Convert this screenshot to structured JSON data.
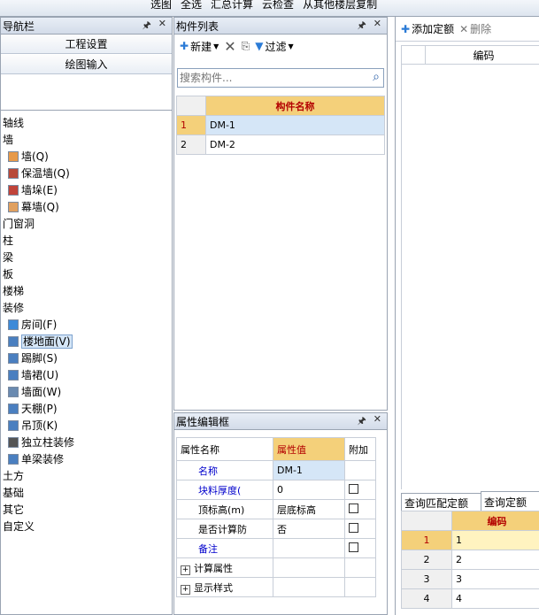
{
  "top_toolbar": {
    "items": [
      "选图",
      "全选",
      "汇总计算",
      "云检查",
      "从其他楼层复制"
    ]
  },
  "nav_panel": {
    "title": "导航栏",
    "buttons": [
      "工程设置",
      "绘图输入"
    ],
    "tree": [
      {
        "label": "轴线",
        "indent": 0
      },
      {
        "label": "墙",
        "indent": 0
      },
      {
        "label": "墙(Q)",
        "indent": 1,
        "icon": "wall-icon"
      },
      {
        "label": "保温墙(Q)",
        "indent": 1,
        "icon": "insulation-wall-icon"
      },
      {
        "label": "墙垛(E)",
        "indent": 1,
        "icon": "wall-pier-icon"
      },
      {
        "label": "幕墙(Q)",
        "indent": 1,
        "icon": "curtain-wall-icon"
      },
      {
        "label": "门窗洞",
        "indent": 0
      },
      {
        "label": "柱",
        "indent": 0
      },
      {
        "label": "梁",
        "indent": 0
      },
      {
        "label": "板",
        "indent": 0
      },
      {
        "label": "楼梯",
        "indent": 0
      },
      {
        "label": "装修",
        "indent": 0
      },
      {
        "label": "房间(F)",
        "indent": 1,
        "icon": "room-icon"
      },
      {
        "label": "楼地面(V)",
        "indent": 1,
        "icon": "floor-icon",
        "selected": true
      },
      {
        "label": "踢脚(S)",
        "indent": 1,
        "icon": "skirting-icon"
      },
      {
        "label": "墙裙(U)",
        "indent": 1,
        "icon": "wainscot-icon"
      },
      {
        "label": "墙面(W)",
        "indent": 1,
        "icon": "wall-surface-icon"
      },
      {
        "label": "天棚(P)",
        "indent": 1,
        "icon": "ceiling-icon"
      },
      {
        "label": "吊顶(K)",
        "indent": 1,
        "icon": "suspended-ceiling-icon"
      },
      {
        "label": "独立柱装修",
        "indent": 1,
        "icon": "column-finish-icon"
      },
      {
        "label": "单梁装修",
        "indent": 1,
        "icon": "beam-finish-icon"
      },
      {
        "label": "土方",
        "indent": 0
      },
      {
        "label": "基础",
        "indent": 0
      },
      {
        "label": "其它",
        "indent": 0
      },
      {
        "label": "自定义",
        "indent": 0
      }
    ]
  },
  "component_list": {
    "title": "构件列表",
    "toolbar": {
      "new_label": "新建",
      "filter_label": "过滤"
    },
    "search_placeholder": "搜索构件...",
    "column_header": "构件名称",
    "rows": [
      {
        "num": "1",
        "name": "DM-1"
      },
      {
        "num": "2",
        "name": "DM-2"
      }
    ]
  },
  "property_panel": {
    "title": "属性编辑框",
    "headers": [
      "属性名称",
      "属性值",
      "附加"
    ],
    "rows": [
      {
        "name": "名称",
        "value": "DM-1",
        "link": true,
        "checkbox": false
      },
      {
        "name": "块料厚度(",
        "value": "0",
        "link": true,
        "checkbox": true
      },
      {
        "name": "顶标高(m)",
        "value": "层底标高",
        "link": false,
        "checkbox": true
      },
      {
        "name": "是否计算防",
        "value": "否",
        "link": false,
        "checkbox": true
      },
      {
        "name": "备注",
        "value": "",
        "link": true,
        "checkbox": true
      },
      {
        "name": "计算属性",
        "value": "",
        "expand": true
      },
      {
        "name": "显示样式",
        "value": "",
        "expand": true
      }
    ]
  },
  "right_panel": {
    "toolbar": {
      "add_quota": "添加定额",
      "delete": "删除"
    },
    "column_header": "编码",
    "tabs": [
      "查询匹配定额",
      "查询定额"
    ],
    "bottom_header": "编码",
    "bottom_rows": [
      {
        "num": "1",
        "code": "1"
      },
      {
        "num": "2",
        "code": "2"
      },
      {
        "num": "3",
        "code": "3"
      },
      {
        "num": "4",
        "code": "4"
      }
    ]
  },
  "icons": {
    "pin": "pin-icon",
    "close": "close-icon",
    "search": "search-icon"
  },
  "colors": {
    "header_bg": "#f4d07a",
    "header_text": "#b30000",
    "selection": "#d5e6f7",
    "link": "#0000cc"
  }
}
